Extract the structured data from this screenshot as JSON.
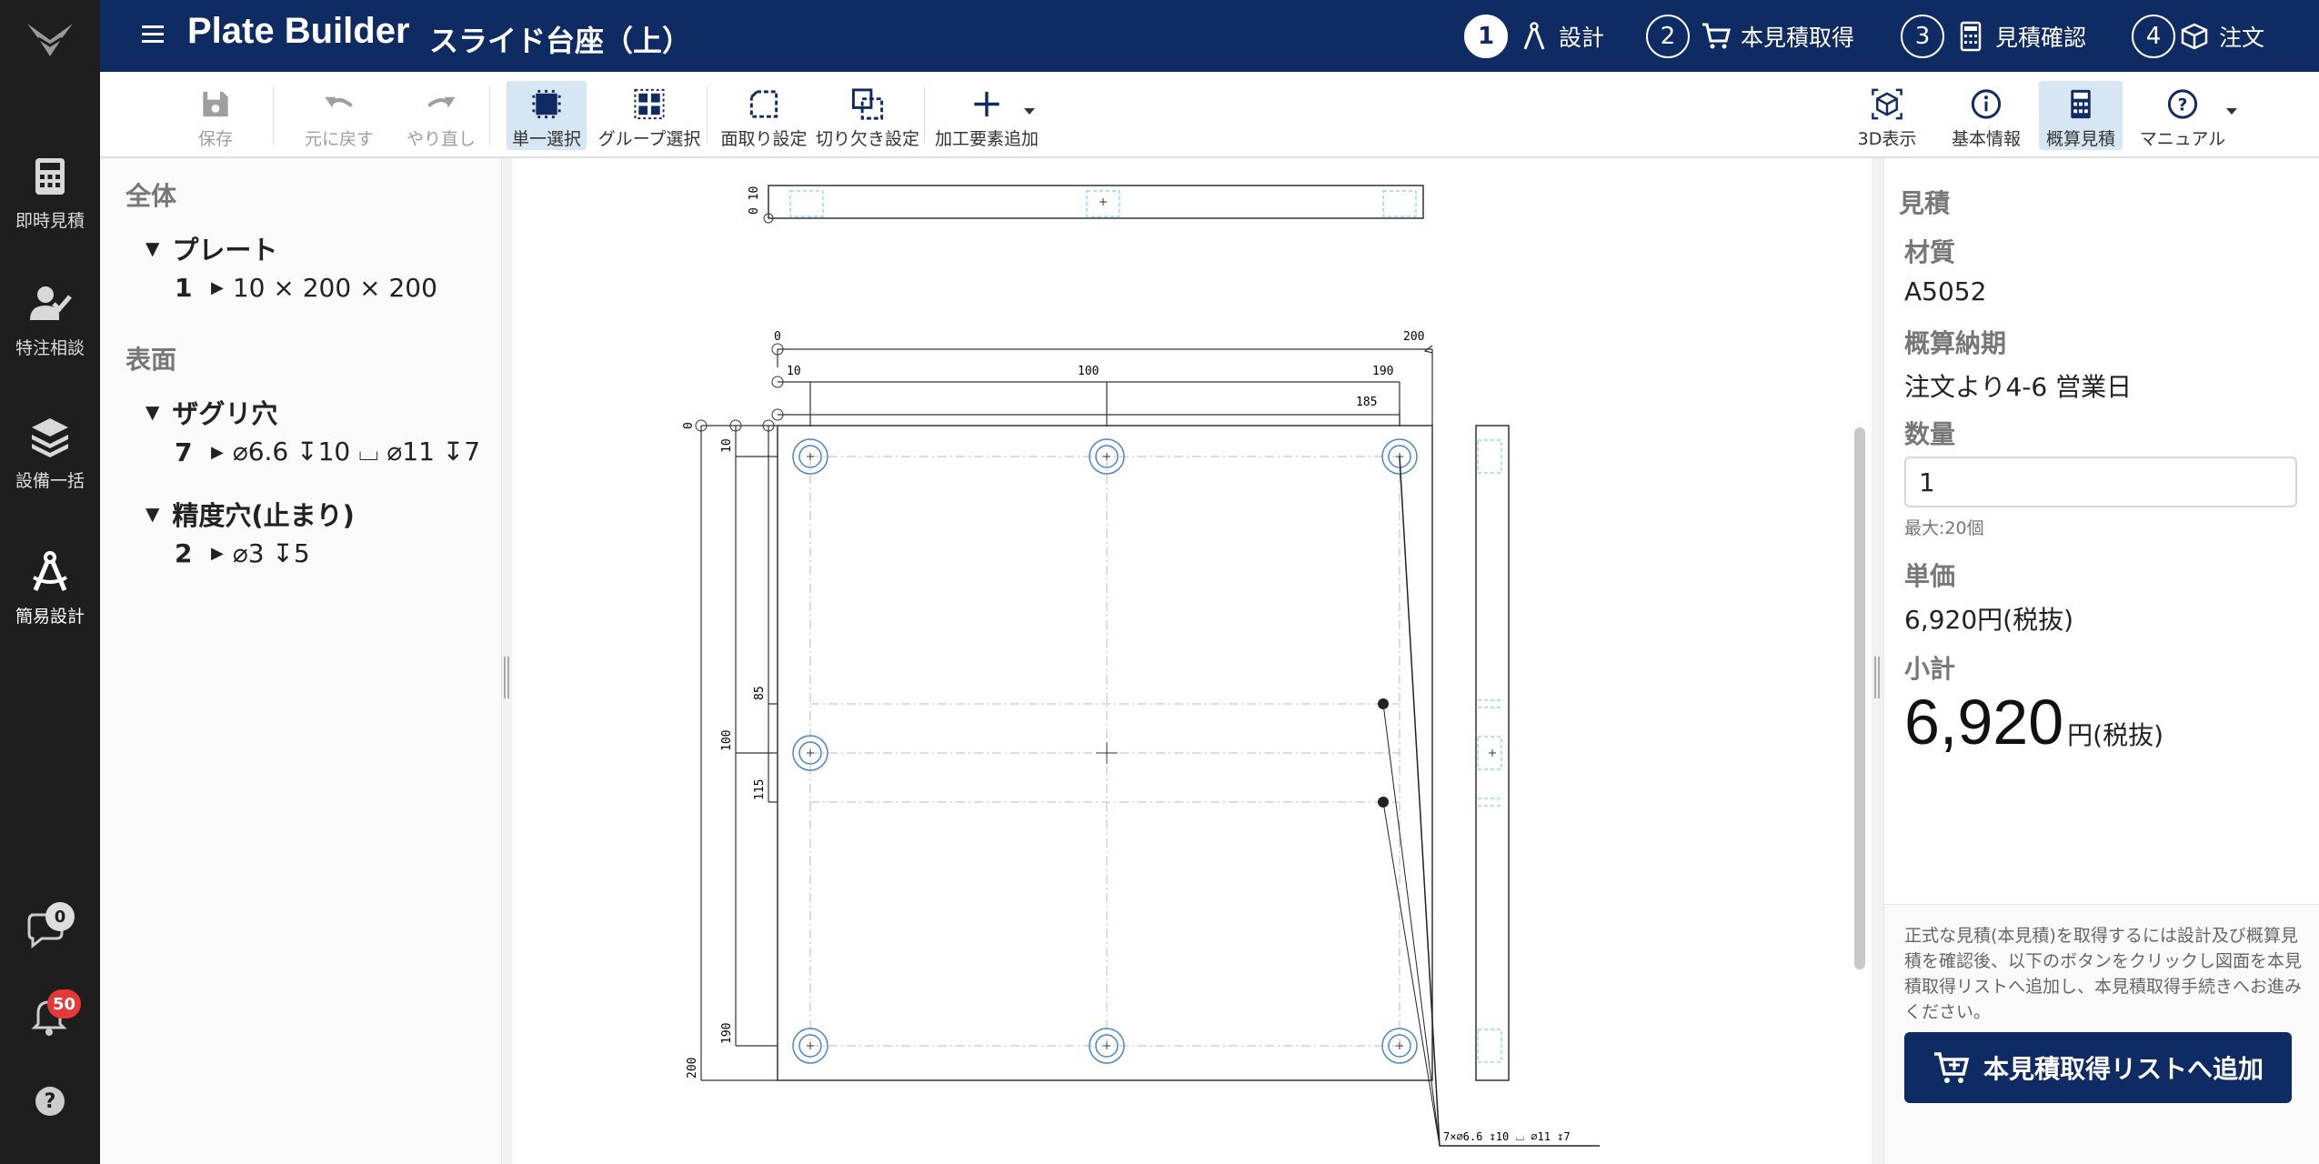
{
  "sidebar": {
    "items": [
      {
        "label": "即時見積",
        "icon": "calculator-icon"
      },
      {
        "label": "特注相談",
        "icon": "user-check-icon"
      },
      {
        "label": "設備一括",
        "icon": "layers-icon"
      },
      {
        "label": "簡易設計",
        "icon": "compass-icon"
      }
    ],
    "chat_count": "0",
    "notification_count": "50"
  },
  "header": {
    "app_title": "Plate Builder",
    "document_title": "スライド台座（上）",
    "steps": [
      {
        "num": "1",
        "label": "設計",
        "icon": "compass-icon"
      },
      {
        "num": "2",
        "label": "本見積取得",
        "icon": "cart-icon"
      },
      {
        "num": "3",
        "label": "見積確認",
        "icon": "calculator-icon"
      },
      {
        "num": "4",
        "label": "注文",
        "icon": "box-icon"
      }
    ]
  },
  "toolbar": {
    "save": "保存",
    "undo": "元に戻す",
    "redo": "やり直し",
    "single_select": "単一選択",
    "group_select": "グループ選択",
    "chamfer": "面取り設定",
    "notch": "切り欠き設定",
    "add_feature": "加工要素追加",
    "view_3d": "3D表示",
    "basic_info": "基本情報",
    "estimate": "概算見積",
    "manual": "マニュアル"
  },
  "tree": {
    "overall": {
      "title": "全体",
      "group": "プレート",
      "rows": [
        {
          "count": "1",
          "text": "10 × 200 × 200"
        }
      ]
    },
    "surface": {
      "title": "表面",
      "groups": [
        {
          "title": "ザグリ穴",
          "rows": [
            {
              "count": "7",
              "text": "⌀6.6 ↧10 ⌴ ⌀11 ↧7"
            }
          ]
        },
        {
          "title": "精度穴(止まり)",
          "rows": [
            {
              "count": "2",
              "text": "⌀3 ↧5"
            }
          ]
        }
      ]
    }
  },
  "drawing": {
    "top_dims": [
      "0",
      "200",
      "10",
      "100",
      "190",
      "185"
    ],
    "left_dims": [
      "0",
      "10",
      "85",
      "100",
      "115",
      "190",
      "200"
    ],
    "side_dim": "0 10",
    "callout": "7×⌀6.6 ↧10 ⌴ ⌀11 ↧7"
  },
  "quote": {
    "title": "見積",
    "material_label": "材質",
    "material": "A5052",
    "lead_time_label": "概算納期",
    "lead_time": "注文より4-6 営業日",
    "quantity_label": "数量",
    "quantity": "1",
    "quantity_hint": "最大:20個",
    "unit_price_label": "単価",
    "unit_price": "6,920円(税抜)",
    "subtotal_label": "小計",
    "subtotal": "6,920",
    "subtotal_unit": "円(税抜)",
    "note": "正式な見積(本見積)を取得するには設計及び概算見積を確認後、以下のボタンをクリックし図面を本見積取得リストへ追加し、本見積取得手続きへお進みください。",
    "cta": "本見積取得リストへ追加"
  },
  "colors": {
    "header_bg": "#0f2b63",
    "rail_bg": "#1e1e1e",
    "selected_tool_bg": "#d7e6f3",
    "hole_blue": "#4a86c8",
    "badge_red": "#e53935"
  }
}
